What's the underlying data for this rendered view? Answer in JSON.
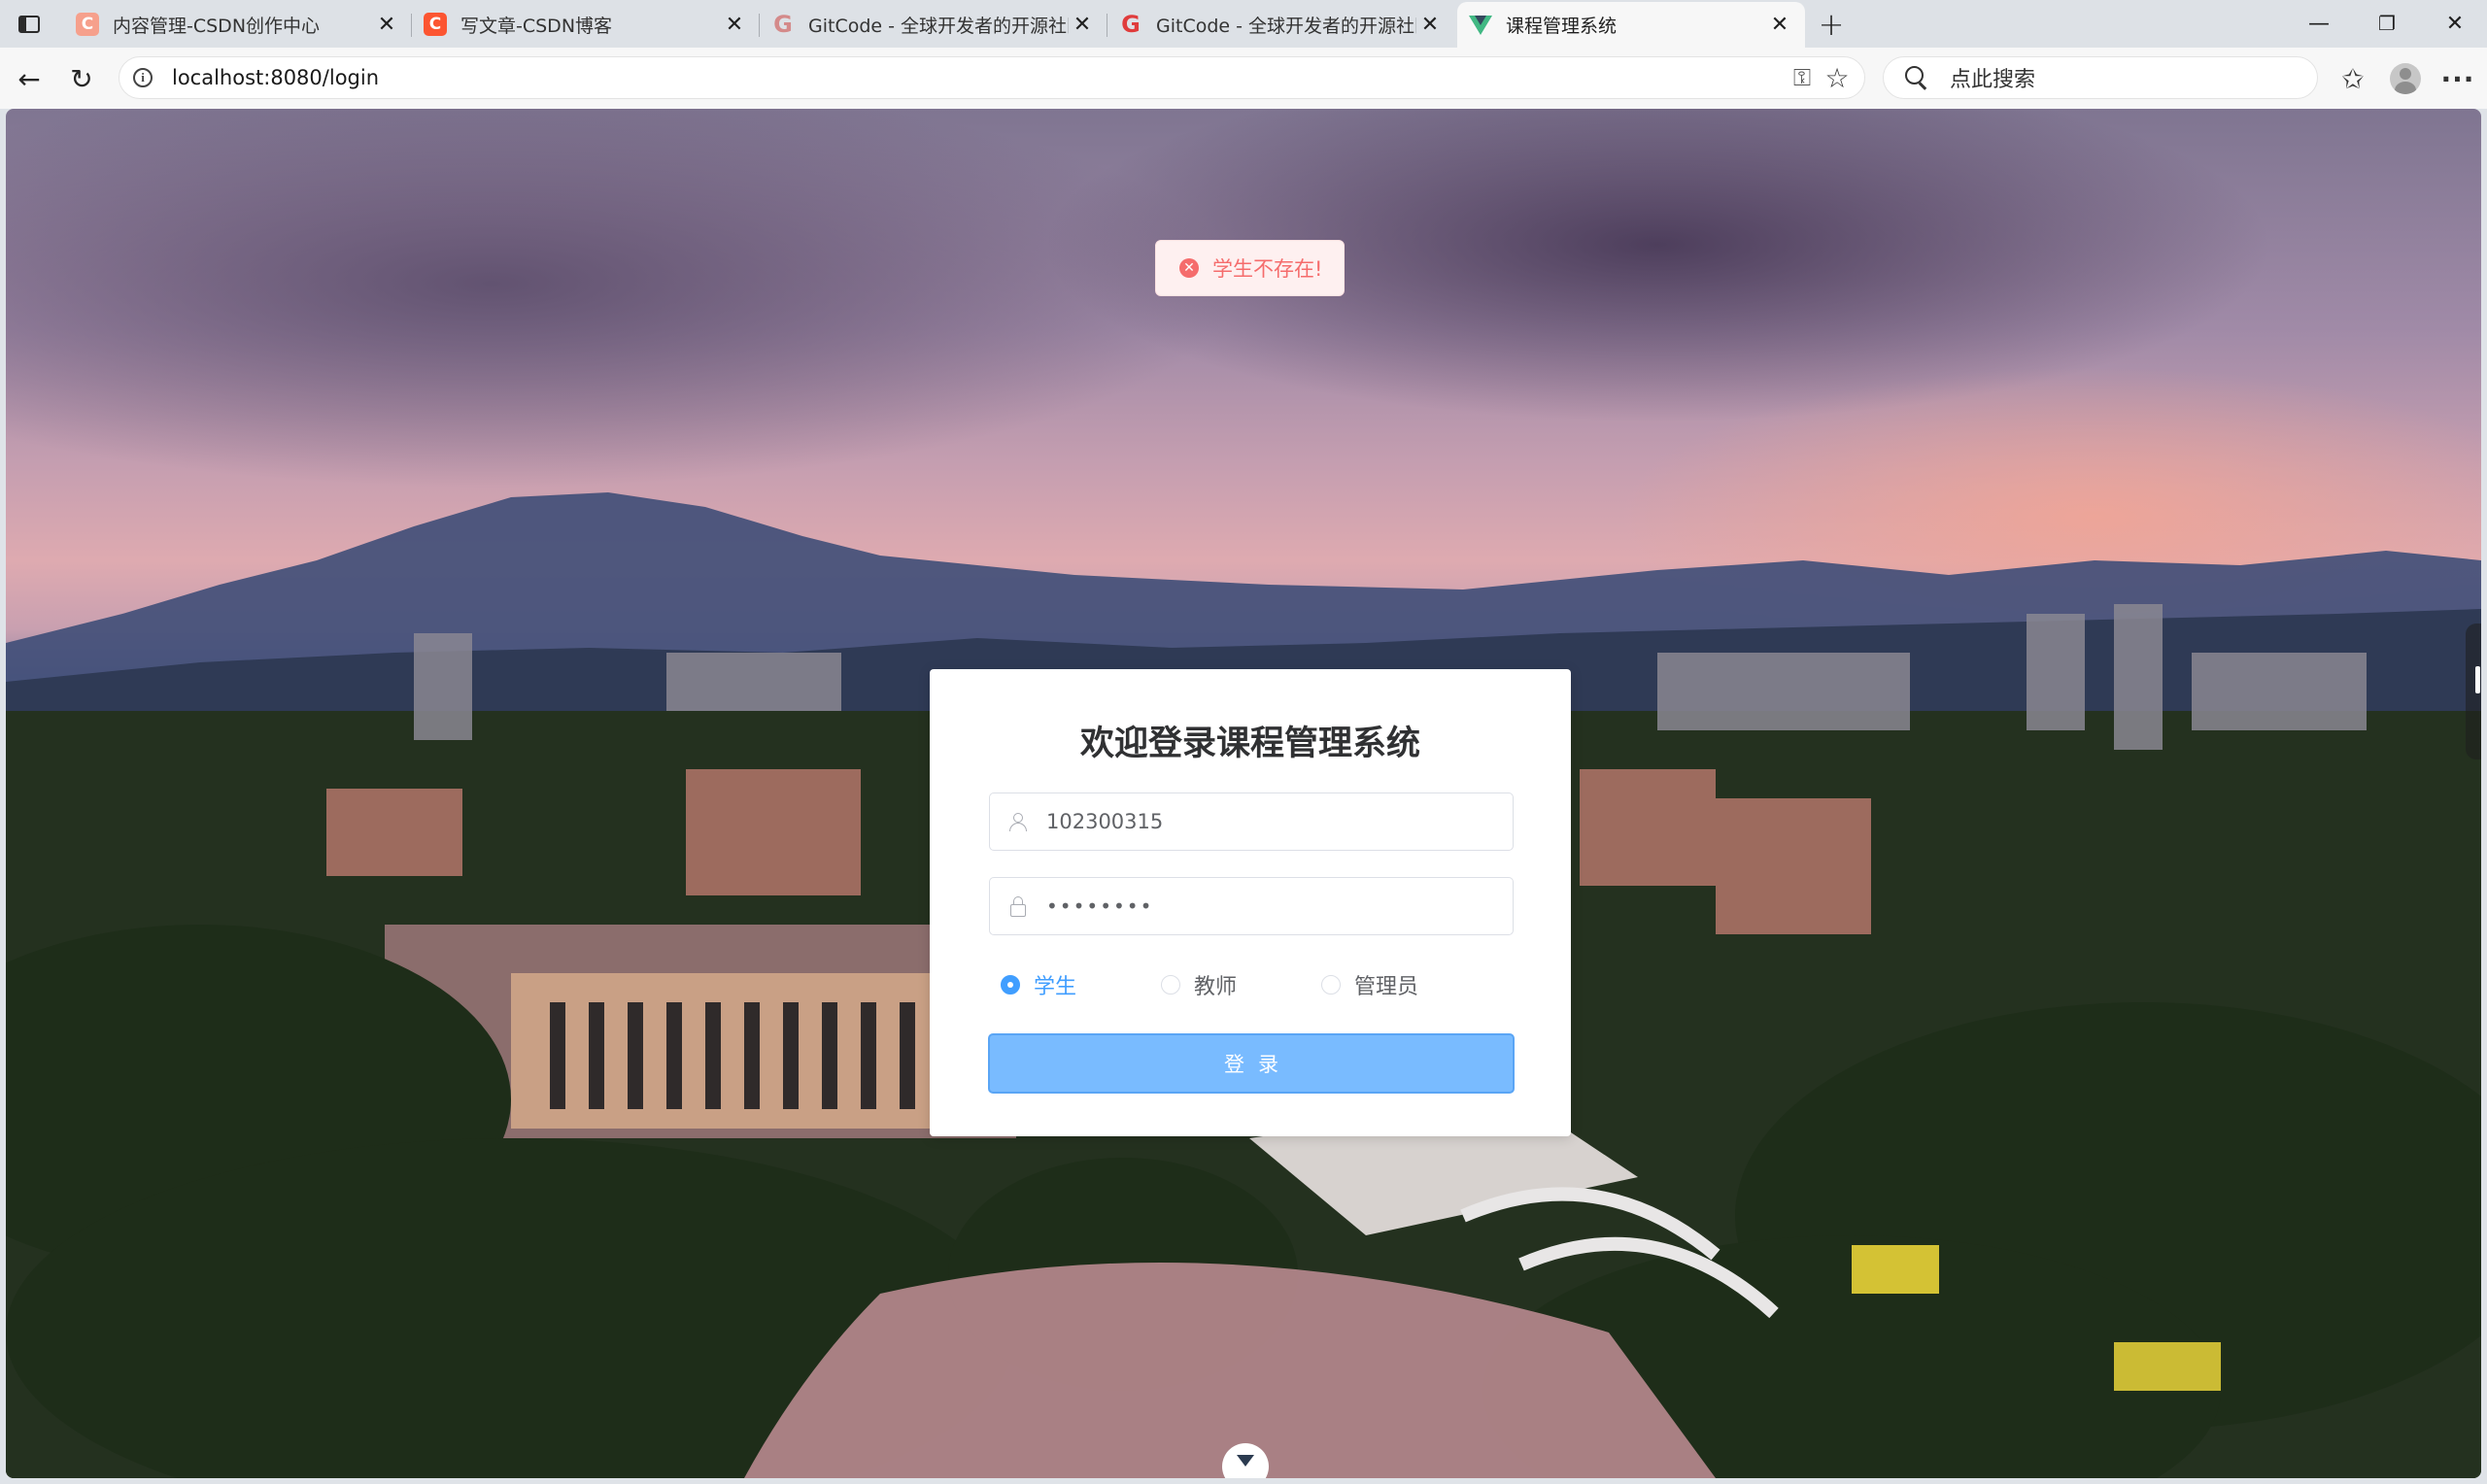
{
  "browser": {
    "tabs": [
      {
        "title": "内容管理-CSDN创作中心",
        "favicon": "csdn-icon",
        "active": false
      },
      {
        "title": "写文章-CSDN博客",
        "favicon": "csdn-icon",
        "active": false
      },
      {
        "title": "GitCode - 全球开发者的开源社区",
        "favicon": "gitcode-icon",
        "active": false
      },
      {
        "title": "GitCode - 全球开发者的开源社区",
        "favicon": "gitcode-icon",
        "active": false
      },
      {
        "title": "课程管理系统",
        "favicon": "vue-icon",
        "active": true
      }
    ],
    "new_tab_label": "+",
    "url": "localhost:8080/login",
    "search_placeholder": "点此搜索"
  },
  "page": {
    "toast": {
      "message": "学生不存在!",
      "type": "error",
      "color": "#f56c6c"
    },
    "login": {
      "title": "欢迎登录课程管理系统",
      "username_value": "102300315",
      "password_value": "••••••••",
      "roles": [
        {
          "label": "学生",
          "checked": true
        },
        {
          "label": "教师",
          "checked": false
        },
        {
          "label": "管理员",
          "checked": false
        }
      ],
      "submit_label": "登录",
      "accent_color": "#409eff"
    }
  }
}
